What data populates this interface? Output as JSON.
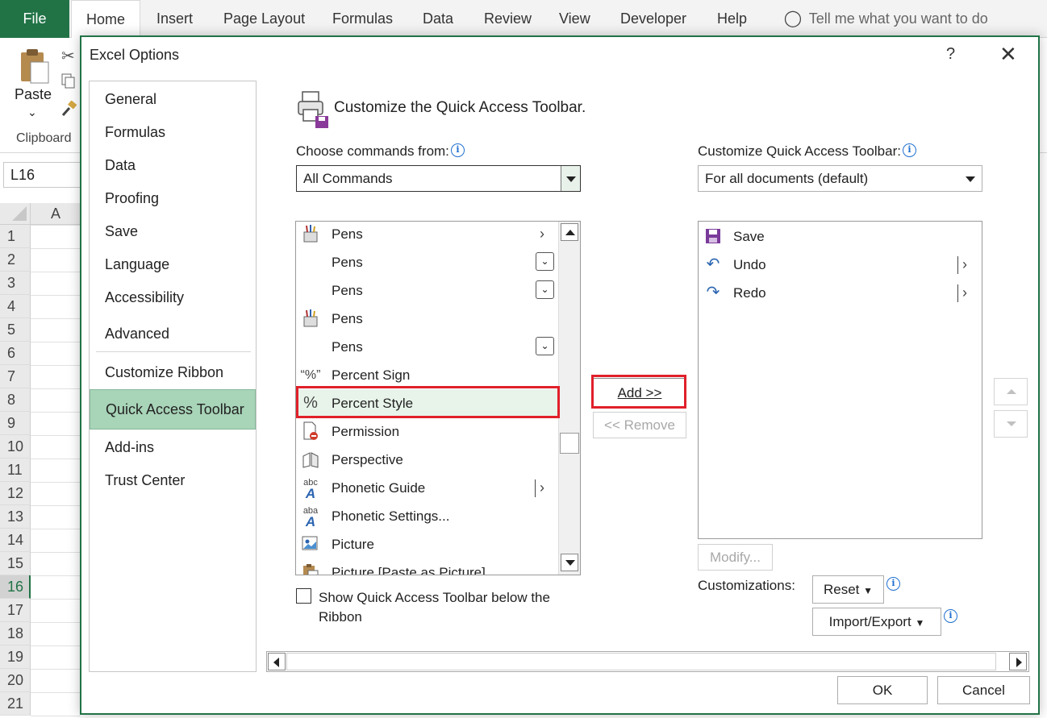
{
  "excel": {
    "tabs": [
      "File",
      "Home",
      "Insert",
      "Page Layout",
      "Formulas",
      "Data",
      "Review",
      "View",
      "Developer",
      "Help"
    ],
    "tell_me": "Tell me what you want to do",
    "paste_label": "Paste",
    "clipboard_label": "Clipboard",
    "name_box": "L16",
    "column_header": "A",
    "rows": [
      "1",
      "2",
      "3",
      "4",
      "5",
      "6",
      "7",
      "8",
      "9",
      "10",
      "11",
      "12",
      "13",
      "14",
      "15",
      "16",
      "17",
      "18",
      "19",
      "20",
      "21"
    ],
    "active_row": "16",
    "accent_color": "#217346"
  },
  "dialog": {
    "title": "Excel Options",
    "help": "?",
    "close": "✕",
    "nav": [
      "General",
      "Formulas",
      "Data",
      "Proofing",
      "Save",
      "Language",
      "Accessibility",
      "Advanced",
      "Customize Ribbon",
      "Quick Access Toolbar",
      "Add-ins",
      "Trust Center"
    ],
    "nav_selected": "Quick Access Toolbar",
    "header": "Customize the Quick Access Toolbar.",
    "choose_label": "Choose commands from:",
    "choose_value": "All Commands",
    "customize_label": "Customize Quick Access Toolbar:",
    "customize_value": "For all documents (default)",
    "commands": [
      {
        "label": "Pens",
        "icon": "pens-icon",
        "suffix": "arrow"
      },
      {
        "label": "Pens",
        "icon": "",
        "suffix": "dropdown"
      },
      {
        "label": "Pens",
        "icon": "",
        "suffix": "dropdown"
      },
      {
        "label": "Pens",
        "icon": "pens-icon",
        "suffix": ""
      },
      {
        "label": "Pens",
        "icon": "",
        "suffix": "dropdown"
      },
      {
        "label": "Percent Sign",
        "icon": "percent-sign-icon",
        "suffix": ""
      },
      {
        "label": "Percent Style",
        "icon": "percent-style-icon",
        "suffix": ""
      },
      {
        "label": "Permission",
        "icon": "permission-icon",
        "suffix": ""
      },
      {
        "label": "Perspective",
        "icon": "perspective-icon",
        "suffix": ""
      },
      {
        "label": "Phonetic Guide",
        "icon": "phonetic-guide-icon",
        "suffix": "split"
      },
      {
        "label": "Phonetic Settings...",
        "icon": "phonetic-settings-icon",
        "suffix": ""
      },
      {
        "label": "Picture",
        "icon": "picture-icon",
        "suffix": ""
      },
      {
        "label": "Picture [Paste as Picture]",
        "icon": "paste-picture-icon",
        "suffix": ""
      }
    ],
    "selected_command": "Percent Style",
    "add_button": "Add >>",
    "remove_button": "<< Remove",
    "toolbar_items": [
      {
        "label": "Save",
        "icon": "save-icon",
        "suffix": ""
      },
      {
        "label": "Undo",
        "icon": "undo-icon",
        "suffix": "split"
      },
      {
        "label": "Redo",
        "icon": "redo-icon",
        "suffix": "split"
      }
    ],
    "modify_button": "Modify...",
    "customizations_label": "Customizations:",
    "reset_button": "Reset",
    "import_export_button": "Import/Export",
    "checkbox_label_line1": "Show Quick Access Toolbar below the",
    "checkbox_label_line2": "Ribbon",
    "ok_button": "OK",
    "cancel_button": "Cancel",
    "highlight_color": "#e0202a",
    "selected_nav_color": "#a8d4b8"
  }
}
